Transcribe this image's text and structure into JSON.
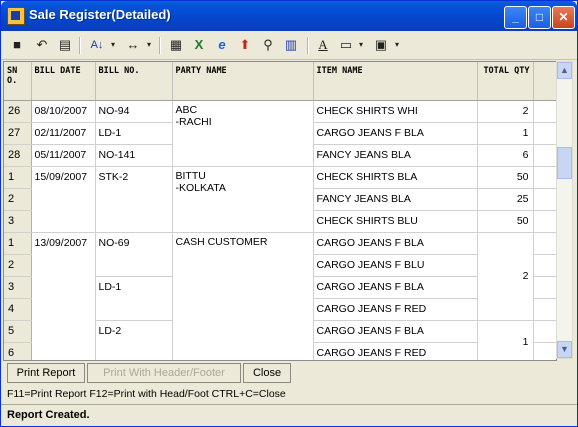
{
  "window": {
    "title": "Sale Register(Detailed)"
  },
  "toolbar": {
    "icons": [
      "save-icon",
      "undo-icon",
      "copy-icon",
      "sort-az-icon",
      "column-width-icon",
      "clipboard-icon",
      "excel-icon",
      "internet-explorer-icon",
      "upload-arrow-icon",
      "find-icon",
      "chart-icon",
      "font-icon",
      "print-preview-icon",
      "printer-icon"
    ]
  },
  "grid": {
    "headers": {
      "sno": "SN O.",
      "bill_date": "BILL DATE",
      "bill_no": "BILL NO.",
      "party": "PARTY NAME",
      "item": "ITEM NAME",
      "qty": "TOTAL QTY"
    },
    "rows": [
      {
        "sno": "26",
        "date": "08/10/2007",
        "bill": "NO-94",
        "party1": "ABC",
        "party2": "-RACHI",
        "item": "CHECK SHIRTS WHI",
        "qty": "2"
      },
      {
        "sno": "27",
        "date": "02/11/2007",
        "bill": "LD-1",
        "party1": "",
        "party2": "",
        "item": "CARGO JEANS F BLA",
        "qty": "1"
      },
      {
        "sno": "28",
        "date": "05/11/2007",
        "bill": "NO-141",
        "party1": "",
        "party2": "",
        "item": "FANCY JEANS BLA",
        "qty": "6"
      },
      {
        "sno": "1",
        "date": "15/09/2007",
        "bill": "STK-2",
        "party1": "BITTU",
        "party2": "-KOLKATA",
        "item": "CHECK SHIRTS BLA",
        "qty": "50"
      },
      {
        "sno": "2",
        "date": "",
        "bill": "",
        "party1": "",
        "party2": "",
        "item": "FANCY JEANS BLA",
        "qty": "25"
      },
      {
        "sno": "3",
        "date": "",
        "bill": "",
        "party1": "",
        "party2": "",
        "item": "CHECK SHIRTS BLU",
        "qty": "50"
      },
      {
        "sno": "1",
        "date": "13/09/2007",
        "bill": "NO-69",
        "party1": "CASH CUSTOMER",
        "party2": "",
        "item": "CARGO JEANS F BLA",
        "qty": ""
      },
      {
        "sno": "2",
        "date": "",
        "bill": "",
        "party1": "",
        "party2": "",
        "item": "CARGO JEANS F BLU",
        "qty": "2"
      },
      {
        "sno": "3",
        "date": "",
        "bill": "LD-1",
        "party1": "",
        "party2": "",
        "item": "CARGO JEANS F BLA",
        "qty": ""
      },
      {
        "sno": "4",
        "date": "",
        "bill": "",
        "party1": "",
        "party2": "",
        "item": "CARGO JEANS F RED",
        "qty": ""
      },
      {
        "sno": "5",
        "date": "",
        "bill": "LD-2",
        "party1": "",
        "party2": "",
        "item": "CARGO JEANS F BLA",
        "qty": "1"
      },
      {
        "sno": "6",
        "date": "",
        "bill": "",
        "party1": "",
        "party2": "",
        "item": "CARGO JEANS F RED",
        "qty": ""
      }
    ]
  },
  "footer": {
    "print_report": "Print Report",
    "print_header_footer": "Print With Header/Footer",
    "close": "Close",
    "help": "F11=Print Report  F12=Print with Head/Foot  CTRL+C=Close"
  },
  "status": {
    "text": "Report Created."
  },
  "colors": {
    "titlebar": "#0451d8",
    "face": "#ece9d8"
  }
}
